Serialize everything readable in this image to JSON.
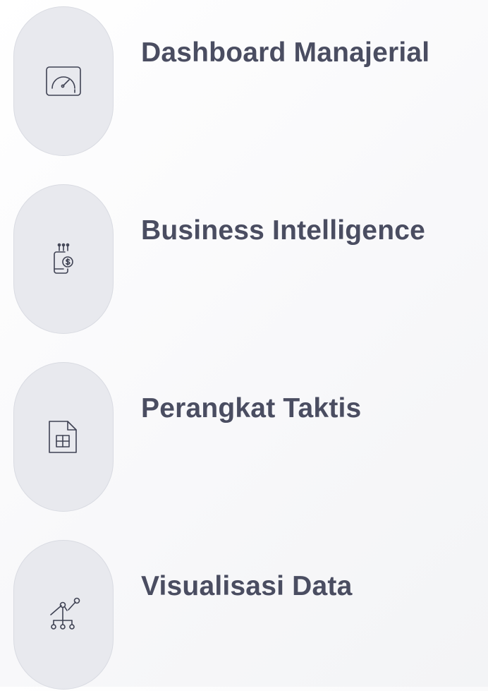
{
  "features": [
    {
      "title": "Dashboard Manajerial",
      "icon": "gauge-icon"
    },
    {
      "title": "Business Intelligence",
      "icon": "mobile-dollar-icon"
    },
    {
      "title": "Perangkat Taktis",
      "icon": "spreadsheet-file-icon"
    },
    {
      "title": "Visualisasi Data",
      "icon": "data-network-chart-icon"
    }
  ],
  "colors": {
    "pill_background": "#e8e9ee",
    "title_text": "#4a4d61",
    "icon_stroke": "#3f4253"
  }
}
